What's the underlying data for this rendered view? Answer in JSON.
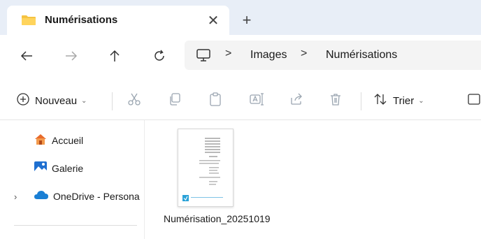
{
  "tab": {
    "title": "Numérisations",
    "close_glyph": "✕",
    "new_tab_glyph": "+"
  },
  "address_bar": {
    "separator": ">",
    "crumbs": [
      "Images",
      "Numérisations"
    ]
  },
  "command_bar": {
    "new_label": "Nouveau",
    "sort_label": "Trier"
  },
  "nav_pane": {
    "items": [
      {
        "label": "Accueil",
        "icon": "home-icon"
      },
      {
        "label": "Galerie",
        "icon": "gallery-icon"
      },
      {
        "label": "OneDrive - Persona",
        "icon": "onedrive-icon"
      }
    ]
  },
  "files": [
    {
      "name": "Numérisation_20251019",
      "icon": "pdf-thumbnail"
    }
  ],
  "colors": {
    "tabbar_bg": "#e8eef7",
    "folder": "#f5c342",
    "onedrive": "#1a7fd4"
  }
}
